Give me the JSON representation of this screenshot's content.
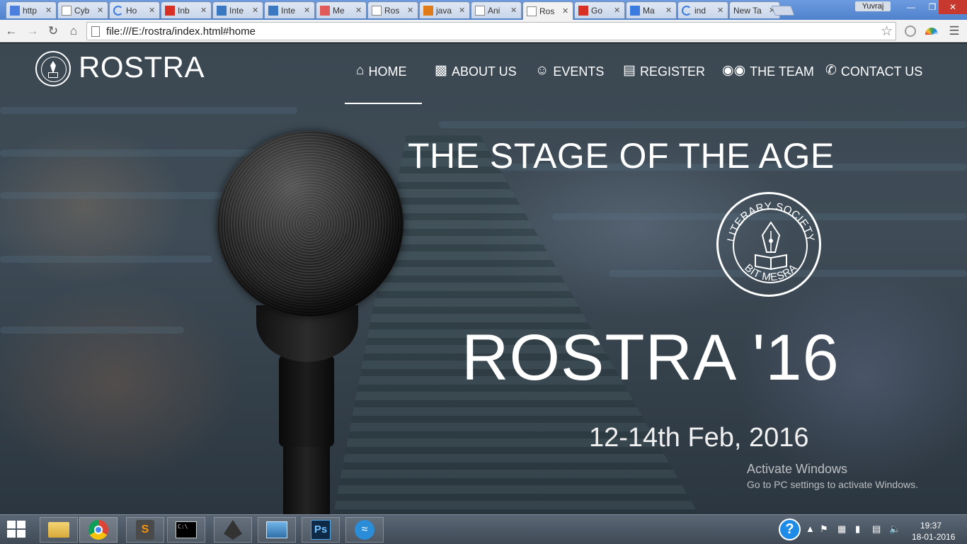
{
  "browser": {
    "tabs": [
      {
        "label": "http",
        "icon": "docs-icon",
        "color": "#4a7fe0"
      },
      {
        "label": "Cyb",
        "icon": "page-icon",
        "color": "#888888"
      },
      {
        "label": "Ho",
        "icon": "loading-icon",
        "color": "#3a7be0"
      },
      {
        "label": "Inb",
        "icon": "gmail-icon",
        "color": "#d93025"
      },
      {
        "label": "Inte",
        "icon": "is-icon",
        "color": "#3a78c2"
      },
      {
        "label": "Inte",
        "icon": "is-icon",
        "color": "#3a78c2"
      },
      {
        "label": "Me",
        "icon": "wave-icon",
        "color": "#e05a5a"
      },
      {
        "label": "Ros",
        "icon": "page-icon",
        "color": "#888888"
      },
      {
        "label": "java",
        "icon": "java-icon",
        "color": "#e07b1a"
      },
      {
        "label": "Ani",
        "icon": "page-icon",
        "color": "#888888"
      },
      {
        "label": "Ros",
        "icon": "page-icon",
        "color": "#888888",
        "active": true
      },
      {
        "label": "Go",
        "icon": "red-square-icon",
        "color": "#d93025"
      },
      {
        "label": "Ma",
        "icon": "gd-icon",
        "color": "#3a7be0"
      },
      {
        "label": "ind",
        "icon": "loading-icon",
        "color": "#3a7be0"
      },
      {
        "label": "New Ta",
        "icon": "",
        "color": "#888888"
      }
    ],
    "profile_name": "Yuvraj",
    "url": "file:///E:/rostra/index.html#home"
  },
  "site": {
    "brand": "ROSTRA",
    "nav": [
      {
        "label": "HOME",
        "icon": "home-icon"
      },
      {
        "label": "ABOUT US",
        "icon": "book-icon"
      },
      {
        "label": "EVENTS",
        "icon": "smiley-icon"
      },
      {
        "label": "REGISTER",
        "icon": "form-icon"
      },
      {
        "label": "THE TEAM",
        "icon": "people-icon"
      },
      {
        "label": "CONTACT US",
        "icon": "phone-icon"
      }
    ],
    "active_nav": "HOME",
    "tagline": "THE STAGE OF THE AGE",
    "seal_top": "LITERARY SOCIETY",
    "seal_bottom": "BIT MESRA",
    "event_title": "ROSTRA '16",
    "event_date": "12-14th Feb, 2016"
  },
  "watermark": {
    "title": "Activate Windows",
    "subtitle": "Go to PC settings to activate Windows."
  },
  "taskbar": {
    "apps": [
      "file-explorer-icon",
      "chrome-icon",
      "sublime-text-icon",
      "command-prompt-icon",
      "inkscape-icon",
      "photos-icon",
      "photoshop-icon",
      "network-icon"
    ],
    "clock_time": "19:37",
    "clock_date": "18-01-2016"
  }
}
